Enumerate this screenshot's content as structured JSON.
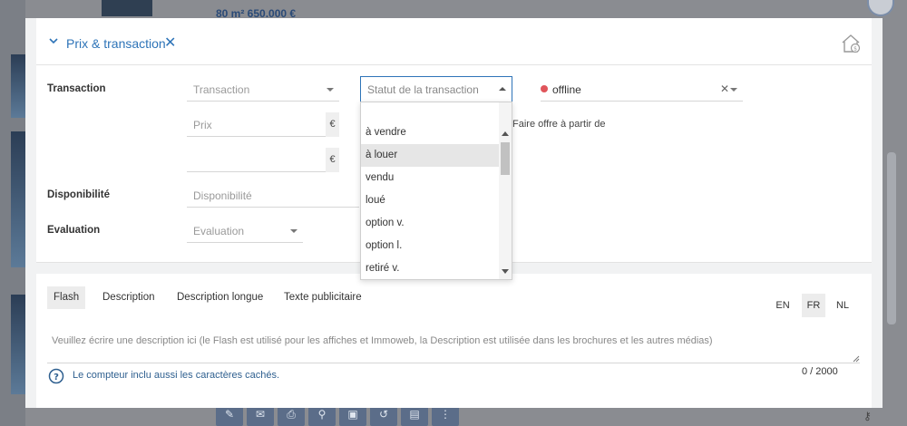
{
  "background": {
    "top_text": "80 m²   650.000 €",
    "toolbar_icons": [
      "pencil-icon",
      "mail-icon",
      "print-icon",
      "search-user-icon",
      "doc-icon",
      "history-icon",
      "file-icon",
      "more-icon"
    ]
  },
  "section": {
    "title": "Prix & transaction"
  },
  "form": {
    "transaction_label": "Transaction",
    "transaction_placeholder": "Transaction",
    "statut_placeholder": "Statut de la transaction",
    "offline_value": "offline",
    "prix_placeholder": "Prix",
    "currency": "€",
    "offre_text": "Faire offre à partir de",
    "disponibilite_label": "Disponibilité",
    "disponibilite_placeholder": "Disponibilité",
    "evaluation_label": "Evaluation",
    "evaluation_placeholder": "Evaluation"
  },
  "dropdown": {
    "items": [
      "à vendre",
      "à louer",
      "vendu",
      "loué",
      "option v.",
      "option l.",
      "retiré v."
    ],
    "selected": "à louer"
  },
  "description": {
    "tabs": [
      "Flash",
      "Description",
      "Description longue",
      "Texte publicitaire"
    ],
    "active_tab": "Flash",
    "languages": [
      "EN",
      "FR",
      "NL"
    ],
    "active_language": "FR",
    "placeholder": "Veuillez écrire une description ici (le Flash est utilisé pour les affiches et Immoweb, la Description est utilisée dans les brochures et les autres médias)",
    "info_text": "Le compteur inclu aussi les caractères cachés.",
    "counter": "0 / 2000"
  },
  "colors": {
    "accent": "#2e74b8",
    "offline_dot": "#e0555b",
    "selected_bg": "#e6e6e6"
  }
}
